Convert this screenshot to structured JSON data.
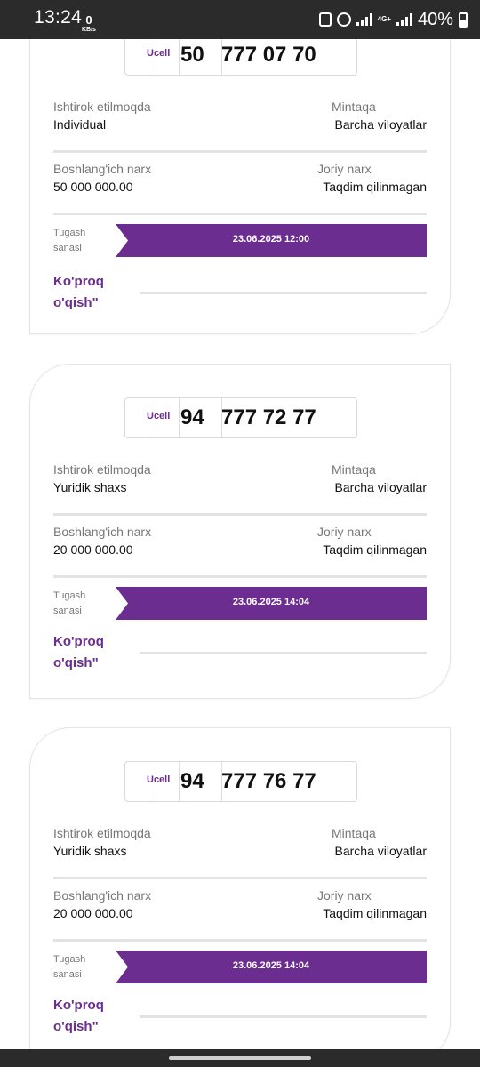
{
  "status": {
    "time": "13:24",
    "net_speed_value": "0",
    "net_speed_unit": "KB/s",
    "network_type": "4G+",
    "battery": "40%"
  },
  "labels": {
    "participant": "Ishtirok etilmoqda",
    "region": "Mintaqa",
    "start_price": "Boshlang'ich narx",
    "current_price": "Joriy narx",
    "deadline_line1": "Tugash",
    "deadline_line2": "sanasi",
    "more_line1": "Ko'proq",
    "more_line2": "o'qish\""
  },
  "cards": [
    {
      "brand": "Ucell",
      "prefix": "50",
      "number": "777 07 70",
      "participant": "Individual",
      "region": "Barcha viloyatlar",
      "start_price": "50 000 000.00",
      "current_price": "Taqdim qilinmagan",
      "deadline": "23.06.2025 12:00"
    },
    {
      "brand": "Ucell",
      "prefix": "94",
      "number": "777 72 77",
      "participant": "Yuridik shaxs",
      "region": "Barcha viloyatlar",
      "start_price": "20 000 000.00",
      "current_price": "Taqdim qilinmagan",
      "deadline": "23.06.2025 14:04"
    },
    {
      "brand": "Ucell",
      "prefix": "94",
      "number": "777 76 77",
      "participant": "Yuridik shaxs",
      "region": "Barcha viloyatlar",
      "start_price": "20 000 000.00",
      "current_price": "Taqdim qilinmagan",
      "deadline": "23.06.2025 14:04"
    }
  ],
  "colors": {
    "brand_purple": "#6b2d8f"
  }
}
